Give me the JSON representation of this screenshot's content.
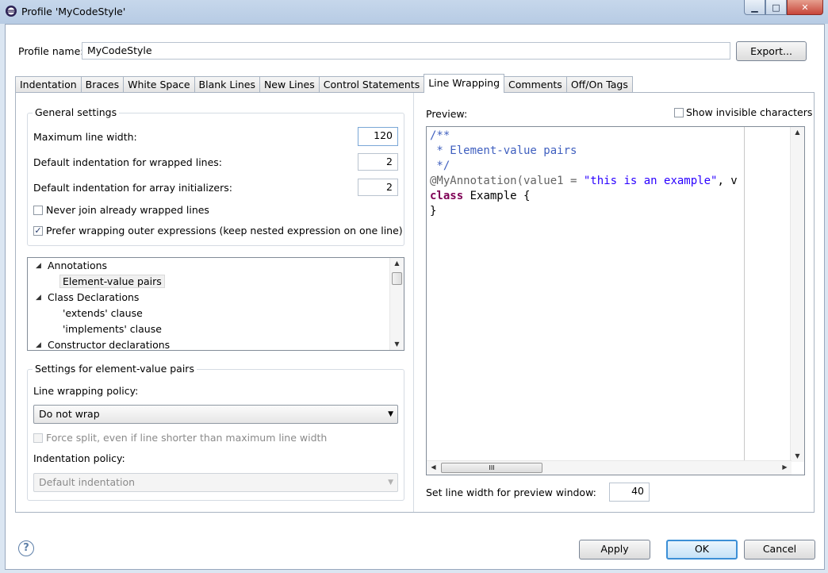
{
  "window": {
    "title": "Profile 'MyCodeStyle'",
    "buttons": {
      "minimize": "▁",
      "maximize": "□",
      "close": "✕"
    }
  },
  "profile": {
    "name_label": "Profile name:",
    "name_value": "MyCodeStyle",
    "export_label": "Export..."
  },
  "tabs": [
    {
      "label": "Indentation"
    },
    {
      "label": "Braces"
    },
    {
      "label": "White Space"
    },
    {
      "label": "Blank Lines"
    },
    {
      "label": "New Lines"
    },
    {
      "label": "Control Statements"
    },
    {
      "label": "Line Wrapping",
      "active": true
    },
    {
      "label": "Comments"
    },
    {
      "label": "Off/On Tags"
    }
  ],
  "general": {
    "title": "General settings",
    "max_width_label": "Maximum line width:",
    "max_width_value": "120",
    "wrapped_indent_label": "Default indentation for wrapped lines:",
    "wrapped_indent_value": "2",
    "array_indent_label": "Default indentation for array initializers:",
    "array_indent_value": "2",
    "never_join_label": "Never join already wrapped lines",
    "never_join_checked": false,
    "prefer_outer_label": "Prefer wrapping outer expressions (keep nested expression on one line)",
    "prefer_outer_checked": true
  },
  "tree": {
    "items": [
      {
        "label": "Annotations",
        "level": 0,
        "expanded": true
      },
      {
        "label": "Element-value pairs",
        "level": 1,
        "selected": true
      },
      {
        "label": "Class Declarations",
        "level": 0,
        "expanded": true
      },
      {
        "label": "'extends' clause",
        "level": 1
      },
      {
        "label": "'implements' clause",
        "level": 1
      },
      {
        "label": "Constructor declarations",
        "level": 0,
        "expanded": true
      }
    ]
  },
  "element_settings": {
    "title": "Settings for element-value pairs",
    "policy_label": "Line wrapping policy:",
    "policy_value": "Do not wrap",
    "force_split_label": "Force split, even if line shorter than maximum line width",
    "indent_policy_label": "Indentation policy:",
    "indent_policy_value": "Default indentation"
  },
  "preview": {
    "label": "Preview:",
    "show_invisible_label": "Show invisible characters",
    "code": {
      "l1": "/**",
      "l2": " * Element-value pairs",
      "l3": " */",
      "l4_ann": "@MyAnnotation(value1 = ",
      "l4_str": "\"this is an example\"",
      "l4_rest": ", v",
      "l5_kw": "class",
      "l5_rest": " Example {",
      "l6": "}"
    },
    "line_width_label": "Set line width for preview window:",
    "line_width_value": "40",
    "hscroll_grip": "III"
  },
  "footer": {
    "help": "?",
    "apply": "Apply",
    "ok": "OK",
    "cancel": "Cancel"
  }
}
